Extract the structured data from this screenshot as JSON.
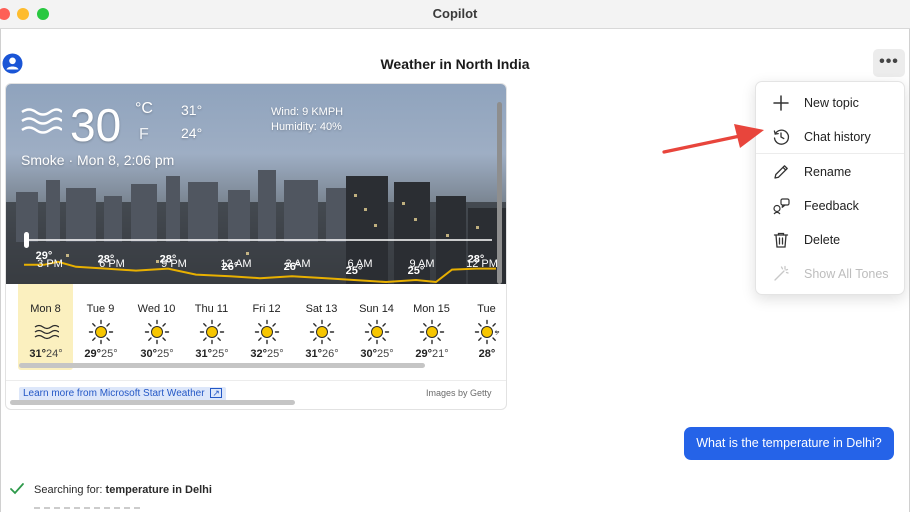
{
  "window": {
    "title": "Copilot"
  },
  "chat": {
    "title": "Weather in North India"
  },
  "weather": {
    "temp": "30",
    "unit_c": "°C",
    "unit_f": "F",
    "high": "31°",
    "low": "24°",
    "wind": "Wind: 9 KMPH",
    "humidity": "Humidity: 40%",
    "condition": "Smoke · Mon 8, 2:06 pm",
    "hourly": {
      "times": [
        "3 PM",
        "6 PM",
        "9 PM",
        "12 AM",
        "3 AM",
        "6 AM",
        "9 AM",
        "12 PM"
      ],
      "point_labels": [
        "29°",
        "28°",
        "28°",
        "26°",
        "26°",
        "25°",
        "25°",
        "28°"
      ],
      "temps": [
        29,
        28,
        28,
        26,
        26,
        25,
        25,
        28
      ],
      "line_color": "#e8b000"
    },
    "forecast": [
      {
        "day": "Mon 8",
        "hi": "31°",
        "lo": "24°",
        "icon": "smoke-icon"
      },
      {
        "day": "Tue 9",
        "hi": "29°",
        "lo": "25°",
        "icon": "sun-icon"
      },
      {
        "day": "Wed 10",
        "hi": "30°",
        "lo": "25°",
        "icon": "sun-icon"
      },
      {
        "day": "Thu 11",
        "hi": "31°",
        "lo": "25°",
        "icon": "sun-icon"
      },
      {
        "day": "Fri 12",
        "hi": "32°",
        "lo": "25°",
        "icon": "sun-icon"
      },
      {
        "day": "Sat 13",
        "hi": "31°",
        "lo": "26°",
        "icon": "sun-icon"
      },
      {
        "day": "Sun 14",
        "hi": "30°",
        "lo": "25°",
        "icon": "sun-icon"
      },
      {
        "day": "Mon 15",
        "hi": "29°",
        "lo": "21°",
        "icon": "sun-icon"
      },
      {
        "day": "Tue",
        "hi": "28°",
        "lo": "",
        "icon": "sun-icon"
      }
    ],
    "learn_more": "Learn more from Microsoft Start Weather",
    "credit": "Images by Getty"
  },
  "menu": {
    "items": [
      {
        "label": "New topic",
        "icon": "plus-icon"
      },
      {
        "label": "Chat history",
        "icon": "history-icon"
      },
      {
        "label": "Rename",
        "icon": "pencil-icon"
      },
      {
        "label": "Feedback",
        "icon": "feedback-icon"
      },
      {
        "label": "Delete",
        "icon": "trash-icon"
      },
      {
        "label": "Show All Tones",
        "icon": "magic-wand-icon",
        "disabled": true
      }
    ]
  },
  "user_message": "What is the temperature in Delhi?",
  "status": {
    "prefix": "Searching for: ",
    "query": "temperature in Delhi"
  },
  "colors": {
    "accent": "#2563e8",
    "arrow": "#e8453c",
    "selected_day": "#fbf0bf"
  }
}
